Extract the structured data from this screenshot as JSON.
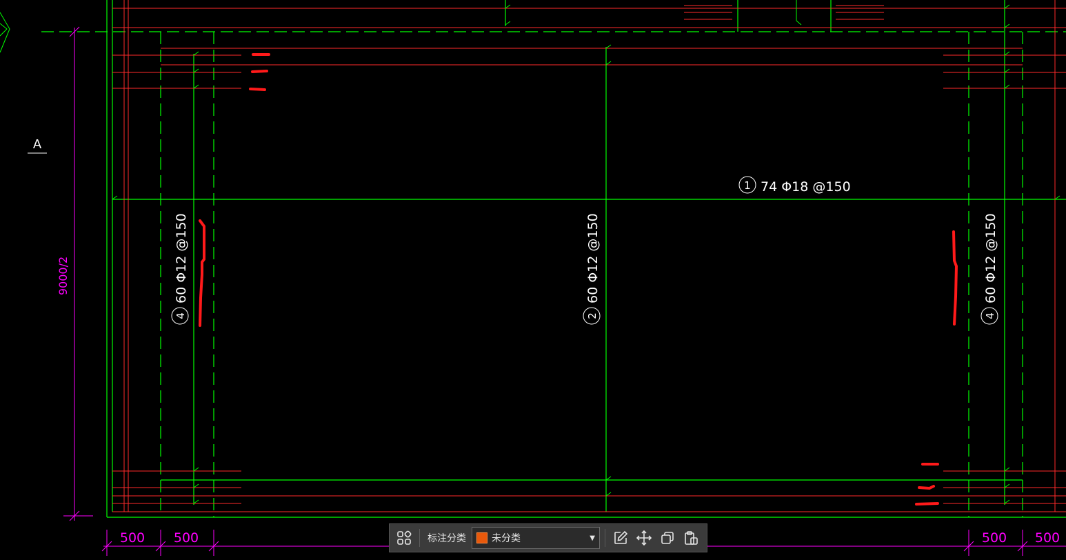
{
  "drawing": {
    "axis_label": "A",
    "vertical_dimension": "9000/2",
    "rebar_labels": [
      {
        "id": "top",
        "mark": "1",
        "text": "74 Φ18 @150"
      },
      {
        "id": "middle",
        "mark": "2",
        "text": "60 Φ12 @150"
      },
      {
        "id": "left",
        "mark": "4",
        "text": "60 Φ12 @150"
      },
      {
        "id": "right",
        "mark": "4",
        "text": "60 Φ12 @150"
      }
    ],
    "bottom_dimensions": [
      "500",
      "500",
      "500",
      "500"
    ],
    "colors": {
      "background": "#000000",
      "green": "#00ff00",
      "red": "#ff2020",
      "magenta": "#ff00ff",
      "white": "#ffffff",
      "markup": "#ff1a1a"
    }
  },
  "toolbar": {
    "grid_icon": "apps-grid-icon",
    "category_label": "标注分类",
    "category_value": "未分类",
    "category_color": "#e8590c",
    "edit_icon": "edit-icon",
    "move_icon": "move-icon",
    "copy_icon": "copy-icon",
    "paste_icon": "paste-icon"
  }
}
